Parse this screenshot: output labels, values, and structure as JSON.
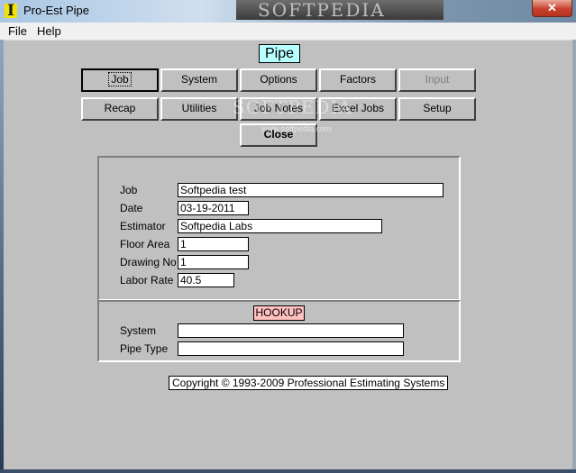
{
  "window": {
    "title": "Pro-Est Pipe",
    "icon": "I",
    "watermark": "SOFTPEDIA",
    "close_label": "✕"
  },
  "menu": [
    "File",
    "Help"
  ],
  "header": {
    "title": "Pipe"
  },
  "buttons_row1": [
    {
      "label": "Job",
      "state": "selected"
    },
    {
      "label": "System",
      "state": "enabled"
    },
    {
      "label": "Options",
      "state": "enabled"
    },
    {
      "label": "Factors",
      "state": "enabled"
    },
    {
      "label": "Input",
      "state": "disabled"
    }
  ],
  "buttons_row2": [
    {
      "label": "Recap"
    },
    {
      "label": "Utilities"
    },
    {
      "label": "Job Notes"
    },
    {
      "label": "Excel Jobs"
    },
    {
      "label": "Setup"
    }
  ],
  "close_button": "Close",
  "overlay_watermark": {
    "text": "SOFTPEDIA",
    "url": "www.softpedia.com"
  },
  "job_form": {
    "job": {
      "label": "Job",
      "value": "Softpedia test"
    },
    "date": {
      "label": "Date",
      "value": "03-19-2011"
    },
    "estimator": {
      "label": "Estimator",
      "value": "Softpedia Labs"
    },
    "floor_area": {
      "label": "Floor Area",
      "value": "1"
    },
    "drawing_no": {
      "label": "Drawing No",
      "value": "1"
    },
    "labor_rate": {
      "label": "Labor Rate",
      "value": "40.5"
    }
  },
  "hookup": {
    "title": "HOOKUP",
    "system": {
      "label": "System",
      "value": ""
    },
    "pipe_type": {
      "label": "Pipe Type",
      "value": ""
    }
  },
  "copyright": "Copyright © 1993-2009 Professional Estimating Systems",
  "colors": {
    "panel": "#c0c0c0",
    "title_box": "#b8ffff",
    "hookup_box": "#ffc0c0"
  }
}
